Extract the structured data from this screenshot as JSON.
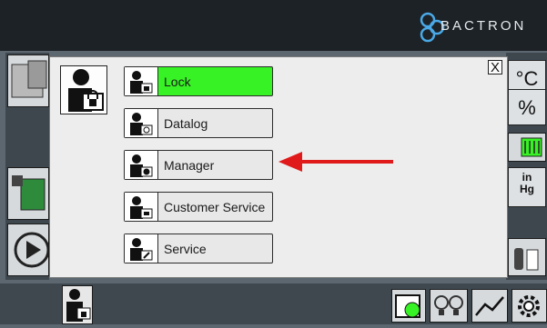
{
  "brand": {
    "logo_text": "BACTRON"
  },
  "units": {
    "temperature": "°C",
    "humidity": "%",
    "pressure_top": "in",
    "pressure_bottom": "Hg"
  },
  "dialog": {
    "close_label": "X",
    "items": [
      {
        "label": "Lock",
        "icon": "padlock-icon",
        "active": true
      },
      {
        "label": "Datalog",
        "icon": "clock-icon",
        "active": false
      },
      {
        "label": "Manager",
        "icon": "manager-icon",
        "active": false
      },
      {
        "label": "Customer Service",
        "icon": "card-icon",
        "active": false
      },
      {
        "label": "Service",
        "icon": "wrench-icon",
        "active": false
      }
    ]
  },
  "colors": {
    "active": "#37f224",
    "annotation_arrow": "#e01a1a",
    "topbar": "#1d2227"
  }
}
